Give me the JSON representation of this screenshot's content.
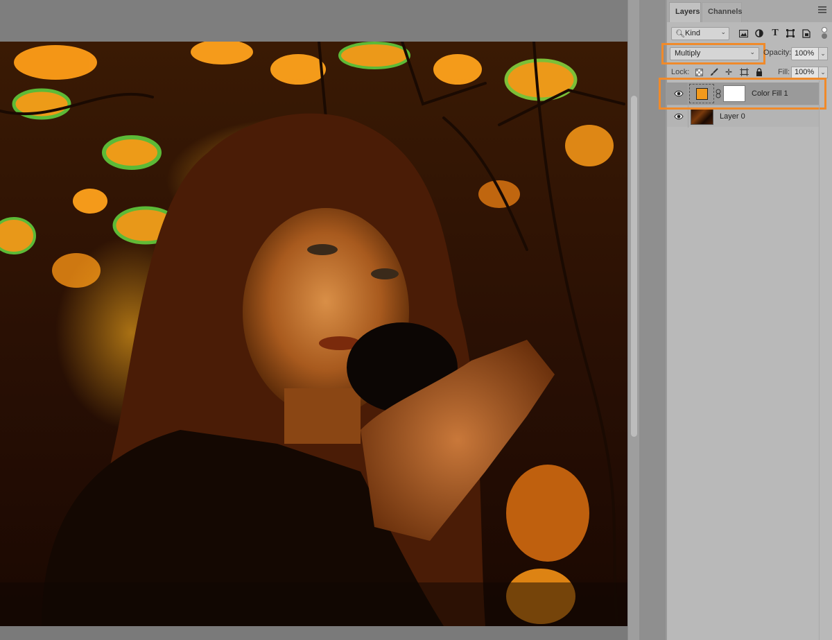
{
  "colors": {
    "accent_highlight": "#f08a2a",
    "fill_color": "#f39a1c",
    "panel_bg": "#b9b9b9",
    "canvas_bg": "#7e7e7e"
  },
  "canvas": {
    "image_description_icon": "photo-canvas"
  },
  "layers_panel": {
    "tabs": [
      {
        "label": "Layers",
        "active": true
      },
      {
        "label": "Channels",
        "active": false
      }
    ],
    "menu_icon": "hamburger-menu-icon",
    "filter": {
      "kind_label": "Kind",
      "icons": [
        "image-filter-icon",
        "adjustment-filter-icon",
        "type-filter-icon",
        "shape-filter-icon",
        "smart-object-filter-icon"
      ]
    },
    "blend_mode": "Multiply",
    "opacity_label": "Opacity:",
    "opacity_value": "100%",
    "lock_label": "Lock:",
    "lock_icons": [
      "lock-transparent-icon",
      "lock-image-icon",
      "lock-position-icon",
      "lock-artboard-icon",
      "lock-all-icon"
    ],
    "fill_label": "Fill:",
    "fill_value": "100%",
    "layers": [
      {
        "name": "Color Fill 1",
        "selected": true,
        "visible": true,
        "type": "color-fill"
      },
      {
        "name": "Layer 0",
        "selected": false,
        "visible": true,
        "type": "image"
      }
    ]
  }
}
